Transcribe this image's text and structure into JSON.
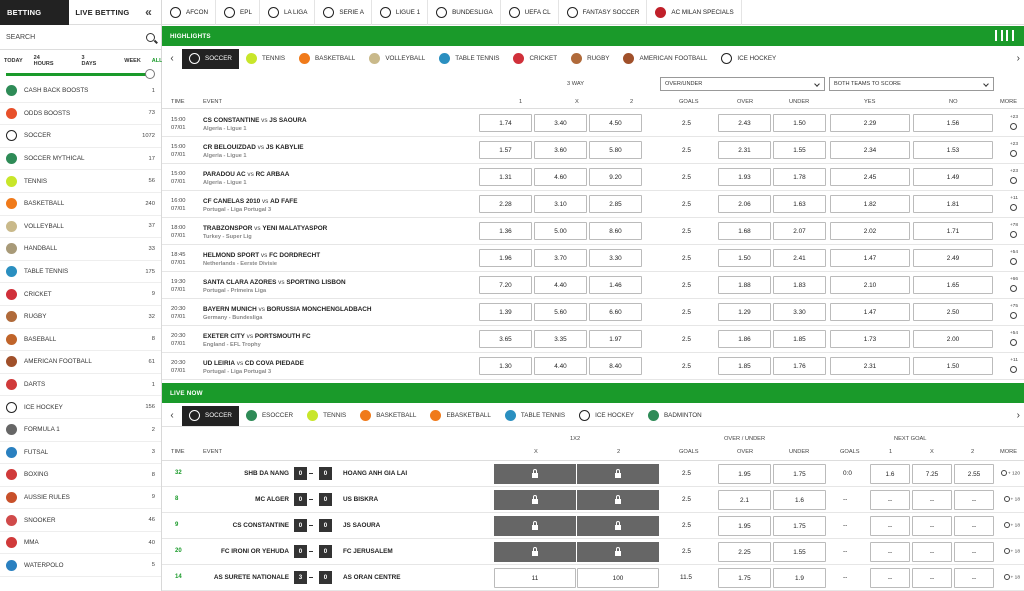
{
  "sidebar": {
    "tabs": {
      "betting": "BETTING",
      "live": "LIVE BETTING",
      "collapse": "«"
    },
    "search_label": "SEARCH",
    "filters": [
      "TODAY",
      "24 HOURS",
      "3 DAYS",
      "WEEK",
      "ALL"
    ],
    "items": [
      {
        "label": "Cash Back Boosts",
        "count": "1",
        "color": "#2e8b57",
        "icon": "cashback-icon"
      },
      {
        "label": "Odds Boosts",
        "count": "73",
        "color": "#e8502a",
        "icon": "boost-icon"
      },
      {
        "label": "Soccer",
        "count": "1072",
        "color": "#222222",
        "icon": "soccer-ball-icon"
      },
      {
        "label": "Soccer Mythical",
        "count": "17",
        "color": "#2e8b57",
        "icon": "mythical-icon"
      },
      {
        "label": "Tennis",
        "count": "56",
        "color": "#c8e62a",
        "icon": "tennis-ball-icon"
      },
      {
        "label": "Basketball",
        "count": "240",
        "color": "#f07a1a",
        "icon": "basketball-icon"
      },
      {
        "label": "Volleyball",
        "count": "37",
        "color": "#c9b98a",
        "icon": "volleyball-icon"
      },
      {
        "label": "Handball",
        "count": "33",
        "color": "#a89a78",
        "icon": "handball-icon"
      },
      {
        "label": "Table Tennis",
        "count": "175",
        "color": "#2a8fc0",
        "icon": "table-tennis-icon"
      },
      {
        "label": "Cricket",
        "count": "9",
        "color": "#d0303a",
        "icon": "cricket-ball-icon"
      },
      {
        "label": "Rugby",
        "count": "32",
        "color": "#b06a3a",
        "icon": "rugby-ball-icon"
      },
      {
        "label": "Baseball",
        "count": "8",
        "color": "#c0642a",
        "icon": "baseball-icon"
      },
      {
        "label": "American Football",
        "count": "61",
        "color": "#a0502a",
        "icon": "american-football-icon"
      },
      {
        "label": "Darts",
        "count": "1",
        "color": "#d03a3a",
        "icon": "darts-icon"
      },
      {
        "label": "Ice Hockey",
        "count": "156",
        "color": "#333333",
        "icon": "ice-hockey-icon"
      },
      {
        "label": "Formula 1",
        "count": "2",
        "color": "#666666",
        "icon": "formula1-flag-icon"
      },
      {
        "label": "Futsal",
        "count": "3",
        "color": "#2a80c0",
        "icon": "futsal-icon"
      },
      {
        "label": "Boxing",
        "count": "8",
        "color": "#d03a3a",
        "icon": "boxing-glove-icon"
      },
      {
        "label": "Aussie Rules",
        "count": "9",
        "color": "#c8502a",
        "icon": "aussie-rules-icon"
      },
      {
        "label": "Snooker",
        "count": "46",
        "color": "#d04a4a",
        "icon": "snooker-icon"
      },
      {
        "label": "MMA",
        "count": "40",
        "color": "#d03a3a",
        "icon": "mma-icon"
      },
      {
        "label": "Waterpolo",
        "count": "5",
        "color": "#2a80c0",
        "icon": "waterpolo-icon"
      }
    ]
  },
  "topnav": [
    {
      "label": "AFCON",
      "color": "#222222",
      "icon": "soccer-ball-icon"
    },
    {
      "label": "EPL",
      "color": "#222222",
      "icon": "soccer-ball-icon"
    },
    {
      "label": "LA LIGA",
      "color": "#222222",
      "icon": "soccer-ball-icon"
    },
    {
      "label": "SERIE A",
      "color": "#222222",
      "icon": "soccer-ball-icon"
    },
    {
      "label": "LIGUE 1",
      "color": "#222222",
      "icon": "soccer-ball-icon"
    },
    {
      "label": "BUNDESLIGA",
      "color": "#222222",
      "icon": "soccer-ball-icon"
    },
    {
      "label": "UEFA CL",
      "color": "#222222",
      "icon": "soccer-ball-icon"
    },
    {
      "label": "FANTASY SOCCER",
      "color": "#222222",
      "icon": "soccer-ball-icon"
    },
    {
      "label": "AC MILAN SPECIALS",
      "color": "#c0202a",
      "icon": "ac-milan-crest-icon"
    }
  ],
  "highlights": {
    "title": "HIGHLIGHTS",
    "tabs": [
      {
        "label": "SOCCER",
        "color": "#ffffff",
        "icon": "soccer-ball-icon",
        "active": true
      },
      {
        "label": "TENNIS",
        "color": "#c8e62a",
        "icon": "tennis-ball-icon"
      },
      {
        "label": "BASKETBALL",
        "color": "#f07a1a",
        "icon": "basketball-icon"
      },
      {
        "label": "VOLLEYBALL",
        "color": "#c9b98a",
        "icon": "volleyball-icon"
      },
      {
        "label": "TABLE TENNIS",
        "color": "#2a8fc0",
        "icon": "table-tennis-icon"
      },
      {
        "label": "CRICKET",
        "color": "#d0303a",
        "icon": "cricket-ball-icon"
      },
      {
        "label": "RUGBY",
        "color": "#b06a3a",
        "icon": "rugby-ball-icon"
      },
      {
        "label": "AMERICAN FOOTBALL",
        "color": "#a0502a",
        "icon": "american-football-icon"
      },
      {
        "label": "ICE HOCKEY",
        "color": "#333333",
        "icon": "ice-hockey-icon"
      }
    ],
    "market_3way": "3 WAY",
    "select_ou": "OVER/UNDER",
    "select_btts": "BOTH TEAMS TO SCORE",
    "headers": {
      "time": "TIME",
      "event": "EVENT",
      "one": "1",
      "x": "X",
      "two": "2",
      "goals": "GOALS",
      "over": "OVER",
      "under": "UNDER",
      "yes": "YES",
      "no": "NO",
      "more": "MORE"
    },
    "rows": [
      {
        "time": "15:00",
        "date": "07/01",
        "home": "CS CONSTANTINE",
        "away": "JS SAOURA",
        "league": "Algeria - Ligue 1",
        "o1": "1.74",
        "ox": "3.40",
        "o2": "4.50",
        "goals": "2.5",
        "over": "2.43",
        "under": "1.50",
        "yes": "2.29",
        "no": "1.56",
        "more": "+23"
      },
      {
        "time": "15:00",
        "date": "07/01",
        "home": "CR BELOUIZDAD",
        "away": "JS KABYLIE",
        "league": "Algeria - Ligue 1",
        "o1": "1.57",
        "ox": "3.60",
        "o2": "5.80",
        "goals": "2.5",
        "over": "2.31",
        "under": "1.55",
        "yes": "2.34",
        "no": "1.53",
        "more": "+23"
      },
      {
        "time": "15:00",
        "date": "07/01",
        "home": "PARADOU AC",
        "away": "RC ARBAA",
        "league": "Algeria - Ligue 1",
        "o1": "1.31",
        "ox": "4.60",
        "o2": "9.20",
        "goals": "2.5",
        "over": "1.93",
        "under": "1.78",
        "yes": "2.45",
        "no": "1.49",
        "more": "+23"
      },
      {
        "time": "16:00",
        "date": "07/01",
        "home": "CF CANELAS 2010",
        "away": "AD FAFE",
        "league": "Portugal - Liga Portugal 3",
        "o1": "2.28",
        "ox": "3.10",
        "o2": "2.85",
        "goals": "2.5",
        "over": "2.06",
        "under": "1.63",
        "yes": "1.82",
        "no": "1.81",
        "more": "+11"
      },
      {
        "time": "18:00",
        "date": "07/01",
        "home": "TRABZONSPOR",
        "away": "YENI MALATYASPOR",
        "league": "Turkey - Super Lig",
        "o1": "1.36",
        "ox": "5.00",
        "o2": "8.60",
        "goals": "2.5",
        "over": "1.68",
        "under": "2.07",
        "yes": "2.02",
        "no": "1.71",
        "more": "+78"
      },
      {
        "time": "18:45",
        "date": "07/01",
        "home": "HELMOND SPORT",
        "away": "FC DORDRECHT",
        "league": "Netherlands - Eerste Divisie",
        "o1": "1.96",
        "ox": "3.70",
        "o2": "3.30",
        "goals": "2.5",
        "over": "1.50",
        "under": "2.41",
        "yes": "1.47",
        "no": "2.49",
        "more": "+54"
      },
      {
        "time": "19:30",
        "date": "07/01",
        "home": "SANTA CLARA AZORES",
        "away": "SPORTING LISBON",
        "league": "Portugal - Primeira Liga",
        "o1": "7.20",
        "ox": "4.40",
        "o2": "1.46",
        "goals": "2.5",
        "over": "1.88",
        "under": "1.83",
        "yes": "2.10",
        "no": "1.65",
        "more": "+66"
      },
      {
        "time": "20:30",
        "date": "07/01",
        "home": "BAYERN MUNICH",
        "away": "BORUSSIA MONCHENGLADBACH",
        "league": "Germany - Bundesliga",
        "o1": "1.39",
        "ox": "5.60",
        "o2": "6.60",
        "goals": "2.5",
        "over": "1.29",
        "under": "3.30",
        "yes": "1.47",
        "no": "2.50",
        "more": "+75"
      },
      {
        "time": "20:30",
        "date": "07/01",
        "home": "EXETER CITY",
        "away": "PORTSMOUTH FC",
        "league": "England - EFL Trophy",
        "o1": "3.65",
        "ox": "3.35",
        "o2": "1.97",
        "goals": "2.5",
        "over": "1.86",
        "under": "1.85",
        "yes": "1.73",
        "no": "2.00",
        "more": "+54"
      },
      {
        "time": "20:30",
        "date": "07/01",
        "home": "UD LEIRIA",
        "away": "CD COVA PIEDADE",
        "league": "Portugal - Liga Portugal 3",
        "o1": "1.30",
        "ox": "4.40",
        "o2": "8.40",
        "goals": "2.5",
        "over": "1.85",
        "under": "1.76",
        "yes": "2.31",
        "no": "1.50",
        "more": "+11"
      }
    ]
  },
  "live": {
    "title": "LIVE NOW",
    "tabs": [
      {
        "label": "SOCCER",
        "color": "#ffffff",
        "icon": "soccer-ball-icon",
        "active": true
      },
      {
        "label": "ESOCCER",
        "color": "#2e8b57",
        "icon": "esoccer-icon"
      },
      {
        "label": "TENNIS",
        "color": "#c8e62a",
        "icon": "tennis-ball-icon"
      },
      {
        "label": "BASKETBALL",
        "color": "#f07a1a",
        "icon": "basketball-icon"
      },
      {
        "label": "EBASKETBALL",
        "color": "#f07a1a",
        "icon": "ebasketball-icon"
      },
      {
        "label": "TABLE TENNIS",
        "color": "#2a8fc0",
        "icon": "table-tennis-icon"
      },
      {
        "label": "ICE HOCKEY",
        "color": "#333333",
        "icon": "ice-hockey-icon"
      },
      {
        "label": "BADMINTON",
        "color": "#2e8b57",
        "icon": "shuttlecock-icon"
      }
    ],
    "market_1x2": "1X2",
    "market_ou": "OVER / UNDER",
    "market_next": "NEXT GOAL",
    "headers": {
      "time": "TIME",
      "event": "EVENT",
      "x": "X",
      "two": "2",
      "goals": "GOALS",
      "over": "OVER",
      "under": "UNDER",
      "goals2": "GOALS",
      "n1": "1",
      "nx": "X",
      "n2": "2",
      "more": "MORE"
    },
    "rows": [
      {
        "min": "32",
        "home": "SHB DA NANG",
        "hs": "0",
        "as": "0",
        "away": "HOANG ANH GIA LAI",
        "locked": true,
        "o1": "",
        "o2": "",
        "goals": "2.5",
        "over": "1.95",
        "under": "1.75",
        "ng_goals": "0:0",
        "ng1": "1.6",
        "ngx": "7.25",
        "ng2": "2.55",
        "more": "+ 120"
      },
      {
        "min": "8",
        "home": "MC ALGER",
        "hs": "0",
        "as": "0",
        "away": "US BISKRA",
        "locked": true,
        "o1": "",
        "o2": "",
        "goals": "2.5",
        "over": "2.1",
        "under": "1.6",
        "ng_goals": "--",
        "ng1": "--",
        "ngx": "--",
        "ng2": "--",
        "more": "+ 18"
      },
      {
        "min": "9",
        "home": "CS CONSTANTINE",
        "hs": "0",
        "as": "0",
        "away": "JS SAOURA",
        "locked": true,
        "o1": "",
        "o2": "",
        "goals": "2.5",
        "over": "1.95",
        "under": "1.75",
        "ng_goals": "--",
        "ng1": "--",
        "ngx": "--",
        "ng2": "--",
        "more": "+ 18"
      },
      {
        "min": "20",
        "home": "FC IRONI OR YEHUDA",
        "hs": "0",
        "as": "0",
        "away": "FC JERUSALEM",
        "locked": true,
        "o1": "",
        "o2": "",
        "goals": "2.5",
        "over": "2.25",
        "under": "1.55",
        "ng_goals": "--",
        "ng1": "--",
        "ngx": "--",
        "ng2": "--",
        "more": "+ 18"
      },
      {
        "min": "14",
        "home": "AS SURETE NATIONALE",
        "hs": "3",
        "as": "0",
        "away": "AS ORAN CENTRE",
        "locked": false,
        "o1": "11",
        "o2": "100",
        "goals": "11.5",
        "over": "1.75",
        "under": "1.9",
        "ng_goals": "--",
        "ng1": "--",
        "ngx": "--",
        "ng2": "--",
        "more": "+ 18"
      }
    ]
  }
}
